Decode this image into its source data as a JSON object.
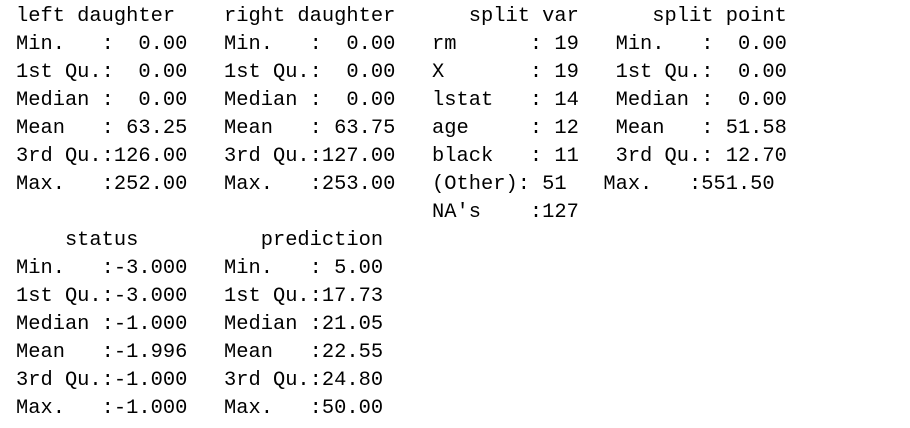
{
  "console": {
    "lines": [
      "left daughter    right daughter      split var      split point   ",
      "Min.   :  0.00   Min.   :  0.00   rm      : 19   Min.   :  0.00  ",
      "1st Qu.:  0.00   1st Qu.:  0.00   X       : 19   1st Qu.:  0.00  ",
      "Median :  0.00   Median :  0.00   lstat   : 14   Median :  0.00  ",
      "Mean   : 63.25   Mean   : 63.75   age     : 12   Mean   : 51.58  ",
      "3rd Qu.:126.00   3rd Qu.:127.00   black   : 11   3rd Qu.: 12.70  ",
      "Max.   :252.00   Max.   :253.00   (Other): 51   Max.   :551.50  ",
      "                                  NA's    :127                   ",
      "    status          prediction   ",
      "Min.   :-3.000   Min.   : 5.00  ",
      "1st Qu.:-3.000   1st Qu.:17.73  ",
      "Median :-1.000   Median :21.05  ",
      "Mean   :-1.996   Mean   :22.55  ",
      "3rd Qu.:-1.000   3rd Qu.:24.80  ",
      "Max.   :-1.000   Max.   :50.00  "
    ]
  }
}
